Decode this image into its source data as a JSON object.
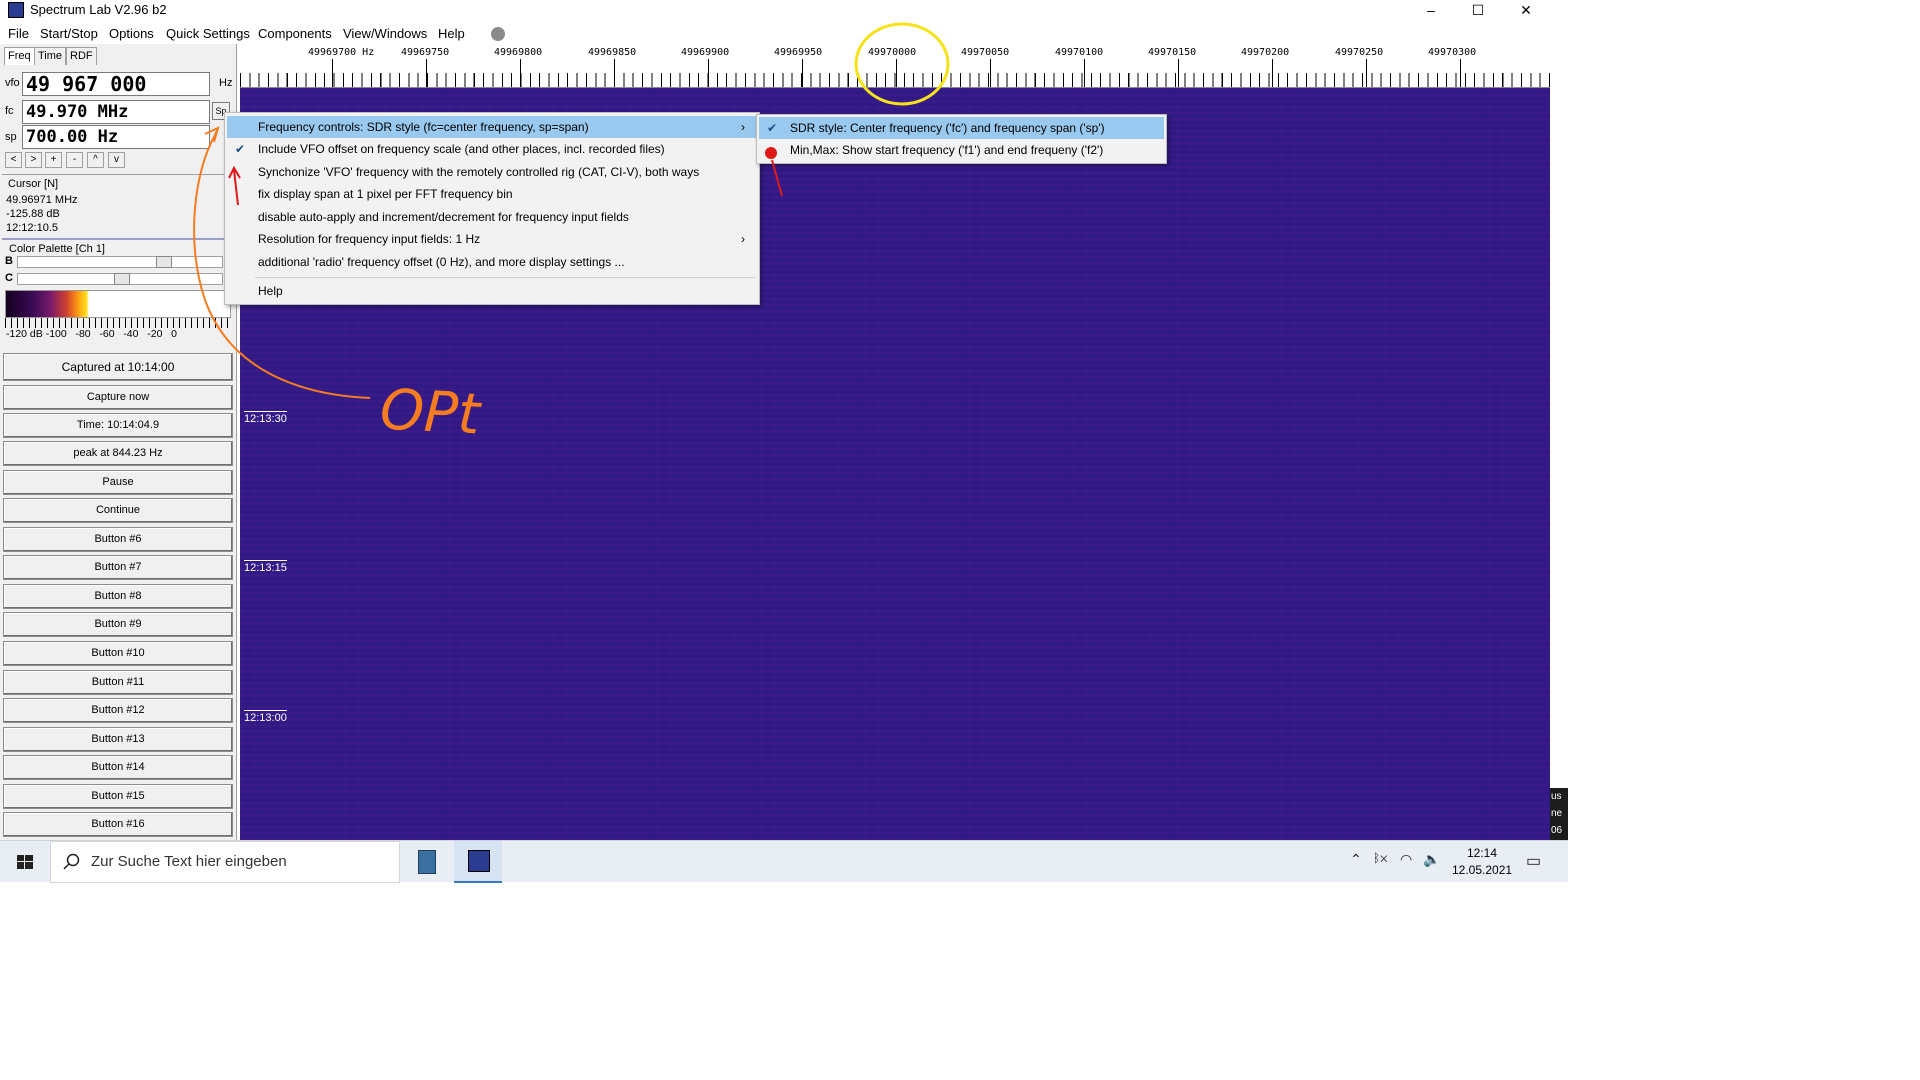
{
  "window": {
    "title": "Spectrum Lab V2.96 b2",
    "controls": [
      "–",
      "☐",
      "✕"
    ]
  },
  "menu": [
    "File",
    "Start/Stop",
    "Options",
    "Quick Settings",
    "Components",
    "View/Windows",
    "Help"
  ],
  "left_panel": {
    "tabs": [
      "Freq",
      "Time",
      "RDF"
    ],
    "vfo_label": "vfo",
    "vfo_value": "49 967 000",
    "vfo_unit": "Hz",
    "fc_label": "fc",
    "fc_value": "49.970 MHz",
    "fc_btn": "Sp",
    "sp_label": "sp",
    "sp_value": "700.00 Hz",
    "step_buttons": [
      "<",
      ">",
      "+",
      "-",
      "^",
      "v"
    ],
    "cursor_title": "Cursor [N]",
    "cursor_freq": "49.96971 MHz",
    "cursor_level": "-125.88 dB",
    "cursor_time": "12:12:10.5",
    "palette_title": "Color Palette [Ch 1]",
    "b_label": "B",
    "c_label": "C",
    "palette_scale": "-120 dB -100   -80   -60   -40   -20   0",
    "buttons": [
      "Captured at 10:14:00",
      "Capture now",
      "Time:  10:14:04.9",
      "peak at 844.23 Hz",
      "Pause",
      "Continue",
      "Button #6",
      "Button #7",
      "Button #8",
      "Button #9",
      "Button #10",
      "Button #11",
      "Button #12",
      "Button #13",
      "Button #14",
      "Button #15",
      "Button #16"
    ]
  },
  "scale": {
    "labels": [
      "49969700 Hz",
      "49969750",
      "49969800",
      "49969850",
      "49969900",
      "49969950",
      "49970000",
      "49970050",
      "49970100",
      "49970150",
      "49970200",
      "49970250",
      "49970300"
    ]
  },
  "waterfall": {
    "time_labels": [
      "12:13:30",
      "12:13:15",
      "12:13:00"
    ],
    "right_strip": [
      "us",
      "ne",
      "06"
    ]
  },
  "context_menu": {
    "items": [
      {
        "label": "Frequency controls: SDR style (fc=center frequency, sp=span)",
        "checked": false,
        "submenu": true,
        "highlight": true
      },
      {
        "label": "Include VFO offset on frequency scale (and other places, incl. recorded files)",
        "checked": true,
        "submenu": false,
        "highlight": false
      },
      {
        "label": "Synchonize 'VFO' frequency with the remotely controlled rig (CAT, CI-V), both ways",
        "checked": false,
        "submenu": false,
        "highlight": false
      },
      {
        "label": "fix display span at 1 pixel per FFT frequency bin",
        "checked": false,
        "submenu": false,
        "highlight": false
      },
      {
        "label": "disable auto-apply and increment/decrement for frequency input fields",
        "checked": false,
        "submenu": false,
        "highlight": false
      },
      {
        "label": "Resolution for frequency input fields: 1 Hz",
        "checked": false,
        "submenu": true,
        "highlight": false
      },
      {
        "label": "additional 'radio' frequency offset (0 Hz), and more display settings ...",
        "checked": false,
        "submenu": false,
        "highlight": false
      }
    ],
    "help": "Help"
  },
  "submenu": {
    "items": [
      {
        "label": "SDR style: Center frequency ('fc') and frequency span ('sp')",
        "checked": true
      },
      {
        "label": "Min,Max: Show start frequency ('f1') and end frequeny ('f2')",
        "checked": false
      }
    ]
  },
  "taskbar": {
    "search_placeholder": "Zur Suche Text hier eingeben",
    "time": "12:14",
    "date": "12.05.2021"
  },
  "annotation": {
    "text": "OPt",
    "orange": "#f57c20",
    "yellow": "#f5e21a",
    "red": "#e01818"
  },
  "colors": {
    "waterfall_bg": "#2d1a86",
    "menu_highlight": "#99c9ef"
  }
}
